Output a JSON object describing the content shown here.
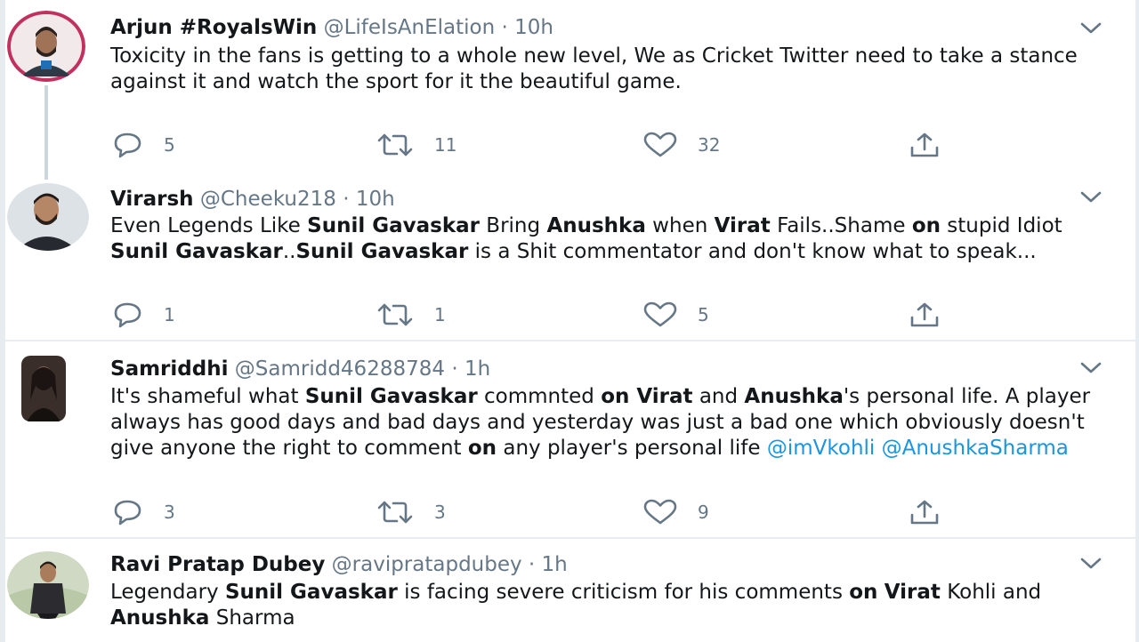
{
  "tweets": [
    {
      "name": "Arjun #RoyalsWin",
      "handle": "@LifeIsAnElation",
      "time": "10h",
      "segments": [
        {
          "t": "Toxicity in the fans is getting to a whole new level, We as Cricket Twitter need to take a stance against it and watch the sport for it the beautiful game.",
          "s": "n"
        }
      ],
      "reply": "5",
      "retweet": "11",
      "like": "32"
    },
    {
      "name": "Virarsh",
      "handle": "@Cheeku218",
      "time": "10h",
      "segments": [
        {
          "t": "Even Legends Like ",
          "s": "n"
        },
        {
          "t": "Sunil Gavaskar",
          "s": "b"
        },
        {
          "t": " Bring ",
          "s": "n"
        },
        {
          "t": "Anushka",
          "s": "b"
        },
        {
          "t": " when ",
          "s": "n"
        },
        {
          "t": "Virat",
          "s": "b"
        },
        {
          "t": " Fails..Shame ",
          "s": "n"
        },
        {
          "t": "on",
          "s": "b"
        },
        {
          "t": "  stupid Idiot ",
          "s": "n"
        },
        {
          "t": "Sunil Gavaskar",
          "s": "b"
        },
        {
          "t": "..",
          "s": "n"
        },
        {
          "t": "Sunil Gavaskar",
          "s": "b"
        },
        {
          "t": " is a Shit commentator and don't know what to speak...",
          "s": "n"
        }
      ],
      "reply": "1",
      "retweet": "1",
      "like": "5"
    },
    {
      "name": "Samriddhi",
      "handle": "@Samridd46288784",
      "time": "1h",
      "segments": [
        {
          "t": "It's shameful what ",
          "s": "n"
        },
        {
          "t": "Sunil Gavaskar",
          "s": "b"
        },
        {
          "t": " commnted ",
          "s": "n"
        },
        {
          "t": "on Virat",
          "s": "b"
        },
        {
          "t": " and ",
          "s": "n"
        },
        {
          "t": "Anushka",
          "s": "b"
        },
        {
          "t": "'s personal life. A player always has good days and bad days and yesterday was just a bad one which obviously doesn't give anyone the right to comment ",
          "s": "n"
        },
        {
          "t": "on",
          "s": "b"
        },
        {
          "t": " any player's personal life ",
          "s": "n"
        },
        {
          "t": "@imVkohli",
          "s": "m"
        },
        {
          "t": " ",
          "s": "n"
        },
        {
          "t": "@AnushkaSharma",
          "s": "m"
        }
      ],
      "reply": "3",
      "retweet": "3",
      "like": "9"
    },
    {
      "name": "Ravi Pratap Dubey",
      "handle": "@ravipratapdubey",
      "time": "1h",
      "segments": [
        {
          "t": "Legendary ",
          "s": "n"
        },
        {
          "t": "Sunil Gavaskar",
          "s": "b"
        },
        {
          "t": " is facing severe criticism for his comments ",
          "s": "n"
        },
        {
          "t": "on",
          "s": "b"
        },
        {
          "t": " ",
          "s": "n"
        },
        {
          "t": "Virat",
          "s": "b"
        },
        {
          "t": " Kohli and ",
          "s": "n"
        },
        {
          "t": "Anushka",
          "s": "b"
        },
        {
          "t": " Sharma",
          "s": "n"
        }
      ]
    }
  ],
  "ui": {
    "separator": "·",
    "colors": {
      "text": "#14171a",
      "muted": "#657786",
      "mention": "#1b95e0",
      "divider": "#e6ecf0",
      "avatar_ring": "#c1305f"
    },
    "icons": {
      "caret": "chevron-down-icon",
      "reply": "reply-icon",
      "retweet": "retweet-icon",
      "like": "like-icon",
      "share": "share-icon"
    }
  }
}
